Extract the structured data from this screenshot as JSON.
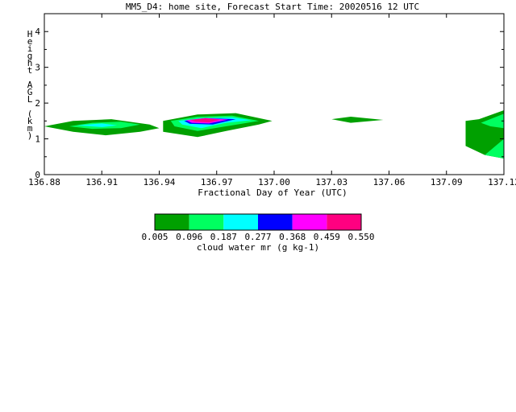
{
  "chart_data": {
    "type": "contour",
    "title": "MM5_D4: home site,  Forecast Start Time: 20020516 12 UTC",
    "xlabel": "Fractional Day of Year (UTC)",
    "ylabel": "Height AGL (km)",
    "xlim": [
      136.88,
      137.12
    ],
    "ylim": [
      0,
      4.5
    ],
    "x_ticks": [
      "136.88",
      "136.91",
      "136.94",
      "136.97",
      "137.00",
      "137.03",
      "137.06",
      "137.09",
      "137.12"
    ],
    "y_ticks": [
      "0",
      "1",
      "2",
      "3",
      "4"
    ],
    "colorbar": {
      "label": "cloud water mr (g kg-1)",
      "levels": [
        "0.005",
        "0.096",
        "0.187",
        "0.277",
        "0.368",
        "0.459",
        "0.550"
      ],
      "colors": [
        "#00a000",
        "#00ff60",
        "#00ffff",
        "#0000ff",
        "#ff00ff",
        "#ff0080"
      ]
    },
    "regions": [
      {
        "level": 0,
        "x": [
          136.88,
          136.895,
          136.915,
          136.935,
          136.94,
          136.93,
          136.912,
          136.895
        ],
        "y": [
          1.35,
          1.5,
          1.55,
          1.4,
          1.3,
          1.2,
          1.1,
          1.2
        ]
      },
      {
        "level": 1,
        "x": [
          136.893,
          136.905,
          136.92,
          136.93,
          136.92,
          136.905
        ],
        "y": [
          1.35,
          1.45,
          1.48,
          1.4,
          1.3,
          1.28
        ]
      },
      {
        "level": 2,
        "x": [
          136.897,
          136.91,
          136.918,
          136.91
        ],
        "y": [
          1.38,
          1.43,
          1.38,
          1.33
        ]
      },
      {
        "level": 0,
        "x": [
          136.942,
          136.96,
          136.98,
          136.999,
          136.992,
          136.975,
          136.96,
          136.942
        ],
        "y": [
          1.5,
          1.68,
          1.72,
          1.5,
          1.4,
          1.22,
          1.05,
          1.2
        ]
      },
      {
        "level": 1,
        "x": [
          136.946,
          136.96,
          136.978,
          136.992,
          136.978,
          136.96,
          136.948
        ],
        "y": [
          1.5,
          1.62,
          1.65,
          1.5,
          1.38,
          1.22,
          1.35
        ]
      },
      {
        "level": 2,
        "x": [
          136.95,
          136.962,
          136.978,
          136.988,
          136.975,
          136.962,
          136.952
        ],
        "y": [
          1.5,
          1.58,
          1.6,
          1.52,
          1.45,
          1.3,
          1.4
        ]
      },
      {
        "level": 3,
        "x": [
          136.953,
          136.964,
          136.98,
          136.968,
          136.956
        ],
        "y": [
          1.5,
          1.58,
          1.55,
          1.4,
          1.42
        ]
      },
      {
        "level": 4,
        "x": [
          136.954,
          136.964,
          136.976,
          136.966,
          136.957
        ],
        "y": [
          1.52,
          1.58,
          1.54,
          1.43,
          1.45
        ]
      },
      {
        "level": 5,
        "x": [
          136.956,
          136.964,
          136.972,
          136.966,
          136.959
        ],
        "y": [
          1.53,
          1.57,
          1.54,
          1.46,
          1.48
        ]
      },
      {
        "level": 0,
        "x": [
          137.03,
          137.04,
          137.057,
          137.04
        ],
        "y": [
          1.55,
          1.62,
          1.53,
          1.45
        ]
      },
      {
        "level": 0,
        "x": [
          137.1,
          137.107,
          137.12,
          137.12,
          137.11,
          137.1
        ],
        "y": [
          1.5,
          1.55,
          1.8,
          0.45,
          0.55,
          0.8
        ]
      },
      {
        "level": 1,
        "x": [
          137.108,
          137.12,
          137.12,
          137.113
        ],
        "y": [
          1.45,
          1.7,
          1.3,
          1.35
        ]
      },
      {
        "level": 1,
        "x": [
          137.11,
          137.12,
          137.12
        ],
        "y": [
          0.55,
          1.0,
          0.45
        ]
      }
    ]
  }
}
